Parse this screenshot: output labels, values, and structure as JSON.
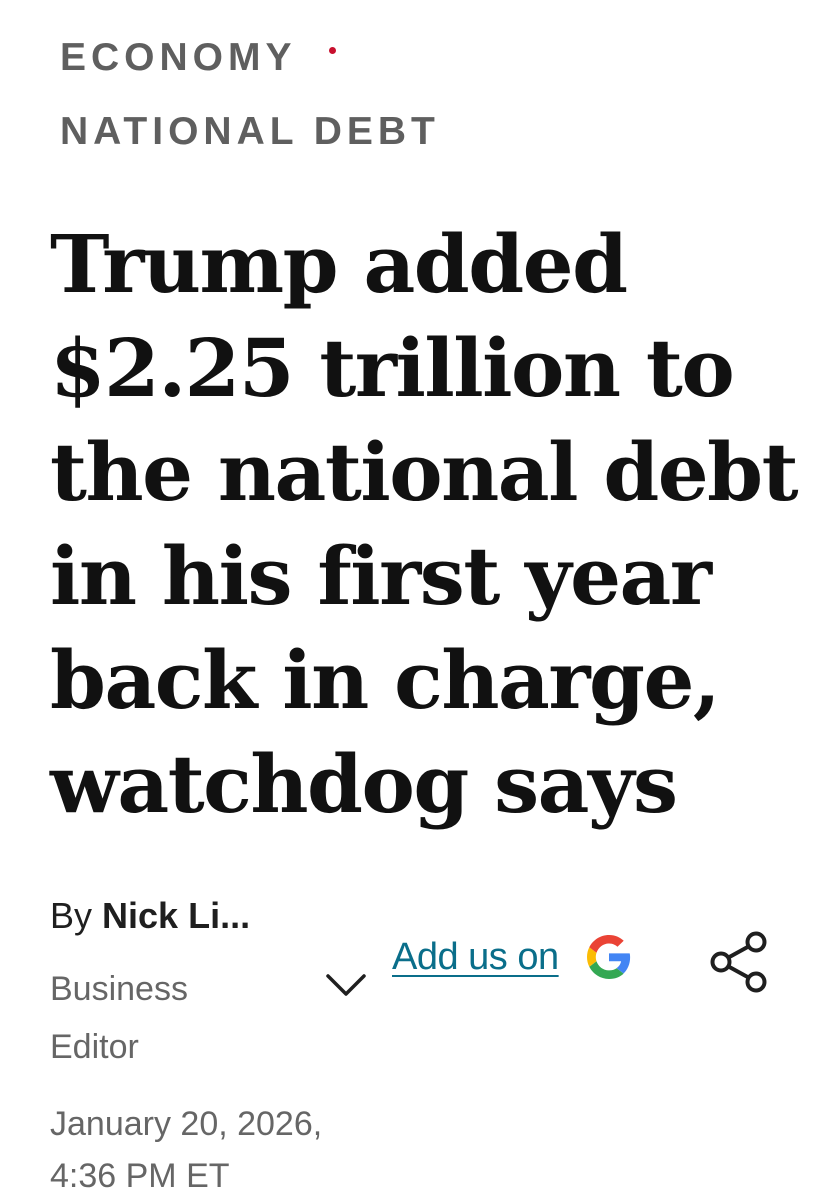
{
  "categories": {
    "primary": "ECONOMY",
    "secondary": "NATIONAL DEBT",
    "separator_color": "#c8102e"
  },
  "headline": {
    "lines": [
      "Trump added",
      "$2.25 trillion to",
      "the national debt",
      "in his first year",
      "back in charge,",
      "watchdog says"
    ]
  },
  "byline": {
    "prefix": "By",
    "author": "Nick Li...",
    "role_line1": "Business",
    "role_line2": "Editor",
    "expand_icon": "chevron-down-icon"
  },
  "google_cta": {
    "label": "Add us on",
    "icon": "google-logo-icon",
    "link_color": "#0a6e8a"
  },
  "share": {
    "icon": "share-icon"
  },
  "dateline": {
    "date": "January 20, 2026,",
    "time": "4:36 PM ET"
  }
}
